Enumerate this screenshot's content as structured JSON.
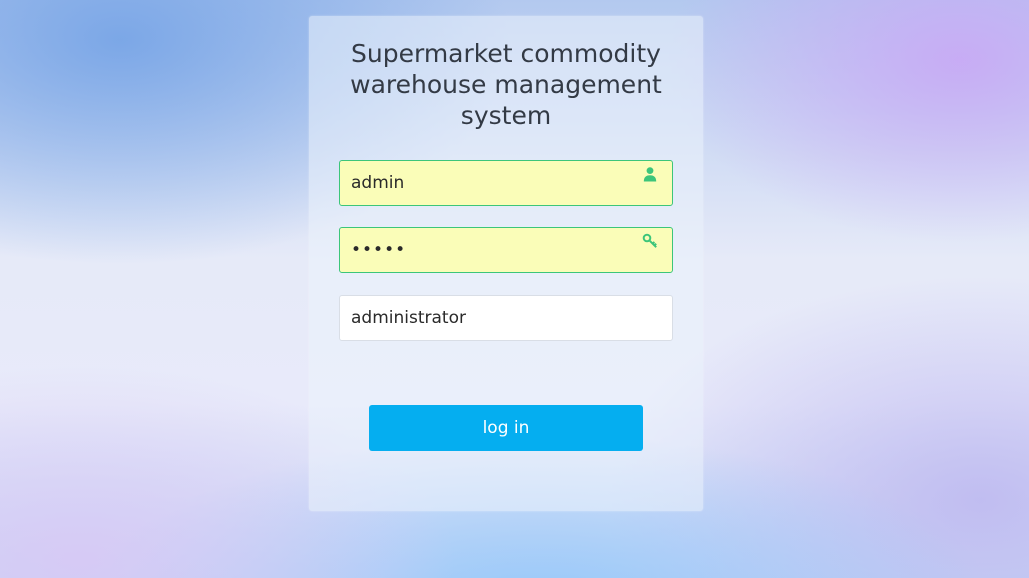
{
  "login": {
    "title": "Supermarket commodity warehouse management system",
    "username": {
      "value": "admin",
      "icon": "user-icon"
    },
    "password": {
      "value": "admin",
      "icon": "key-icon"
    },
    "role": {
      "value": "administrator"
    },
    "submit_label": "log in"
  },
  "colors": {
    "accent": "#05aef0",
    "autofill_bg": "#fafdb8",
    "autofill_border": "#3cc57a",
    "icon_green": "#3cc57a"
  }
}
